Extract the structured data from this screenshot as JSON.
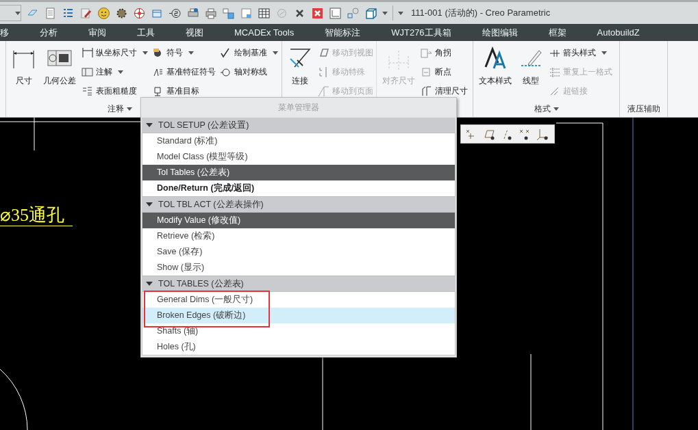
{
  "window": {
    "title": "111-001 (活动的) - Creo Parametric"
  },
  "menu_tabs": [
    {
      "label": "移"
    },
    {
      "label": "分析"
    },
    {
      "label": "审阅"
    },
    {
      "label": "工具"
    },
    {
      "label": "视图"
    },
    {
      "label": "MCADEx Tools"
    },
    {
      "label": "智能标注"
    },
    {
      "label": "WJT276工具箱"
    },
    {
      "label": "绘图编辑"
    },
    {
      "label": "框架"
    },
    {
      "label": "AutobuildZ"
    }
  ],
  "ribbon": {
    "groups": [
      {
        "label": "注释",
        "dropdown": true,
        "items": [
          {
            "kind": "large",
            "label": "尺寸",
            "disabled": false
          },
          {
            "kind": "large",
            "label": "几何公差",
            "disabled": false
          },
          {
            "kind": "stack",
            "rows": [
              {
                "label": "纵坐标尺寸",
                "dropdown": true,
                "disabled": false
              },
              {
                "label": "注解",
                "dropdown": true,
                "disabled": false
              },
              {
                "label": "表面粗糙度",
                "dropdown": false,
                "disabled": false
              }
            ]
          },
          {
            "kind": "stack",
            "rows": [
              {
                "label": "符号",
                "dropdown": true,
                "disabled": false
              },
              {
                "label": "基准特征符号",
                "dropdown": false,
                "disabled": false
              },
              {
                "label": "基准目标",
                "dropdown": false,
                "disabled": false
              }
            ]
          },
          {
            "kind": "stack",
            "rows": [
              {
                "label": "绘制基准",
                "dropdown": true,
                "disabled": false
              },
              {
                "label": "轴对称线",
                "dropdown": false,
                "disabled": false
              }
            ]
          }
        ]
      },
      {
        "items": [
          {
            "kind": "large",
            "label": "连接",
            "disabled": false
          },
          {
            "kind": "stack",
            "rows": [
              {
                "label": "移动到视图",
                "dropdown": false,
                "disabled": true
              },
              {
                "label": "移动特殊",
                "dropdown": false,
                "disabled": true
              },
              {
                "label": "移动到页面",
                "dropdown": false,
                "disabled": true
              }
            ]
          }
        ]
      },
      {
        "items": [
          {
            "kind": "large",
            "label": "对齐尺寸",
            "disabled": true
          },
          {
            "kind": "stack",
            "rows": [
              {
                "label": "角拐",
                "dropdown": false,
                "disabled": false
              },
              {
                "label": "断点",
                "dropdown": false,
                "disabled": false
              },
              {
                "label": "清理尺寸",
                "dropdown": false,
                "disabled": false
              }
            ]
          }
        ]
      },
      {
        "label": "格式",
        "dropdown": true,
        "items": [
          {
            "kind": "large",
            "label": "文本样式",
            "disabled": false
          },
          {
            "kind": "large",
            "label": "线型",
            "disabled": false
          },
          {
            "kind": "stack",
            "rows": [
              {
                "label": "箭头样式",
                "dropdown": true,
                "disabled": false
              },
              {
                "label": "重复上一格式",
                "dropdown": false,
                "disabled": true
              },
              {
                "label": "超链接",
                "dropdown": false,
                "disabled": true
              }
            ]
          }
        ]
      },
      {
        "label": "液压辅助",
        "dropdown": false
      }
    ]
  },
  "canvas": {
    "annotation": "⌀35通孔"
  },
  "menu_manager": {
    "title": "菜单管理器",
    "sections": [
      {
        "heading": "TOL SETUP (公差设置)",
        "items": [
          {
            "label": "Standard (标准)",
            "selected": false,
            "hovered": false,
            "bold": false
          },
          {
            "label": "Model Class (模型等级)",
            "selected": false,
            "hovered": false,
            "bold": false
          },
          {
            "label": "Tol Tables (公差表)",
            "selected": true,
            "hovered": false,
            "bold": false
          },
          {
            "label": "Done/Return (完成/返回)",
            "selected": false,
            "hovered": false,
            "bold": true
          }
        ]
      },
      {
        "heading": "TOL TBL ACT (公差表操作)",
        "items": [
          {
            "label": "Modify Value (修改值)",
            "selected": true,
            "hovered": false,
            "bold": false
          },
          {
            "label": "Retrieve (检索)",
            "selected": false,
            "hovered": false,
            "bold": false
          },
          {
            "label": "Save (保存)",
            "selected": false,
            "hovered": false,
            "bold": false
          },
          {
            "label": "Show (显示)",
            "selected": false,
            "hovered": false,
            "bold": false
          }
        ]
      },
      {
        "heading": "TOL TABLES (公差表)",
        "items": [
          {
            "label": "General Dims (一般尺寸)",
            "selected": false,
            "hovered": false,
            "bold": false
          },
          {
            "label": "Broken Edges (破断边)",
            "selected": false,
            "hovered": true,
            "bold": false
          },
          {
            "label": "Shafts (轴)",
            "selected": false,
            "hovered": false,
            "bold": false
          },
          {
            "label": "Holes (孔)",
            "selected": false,
            "hovered": false,
            "bold": false
          }
        ]
      }
    ]
  }
}
